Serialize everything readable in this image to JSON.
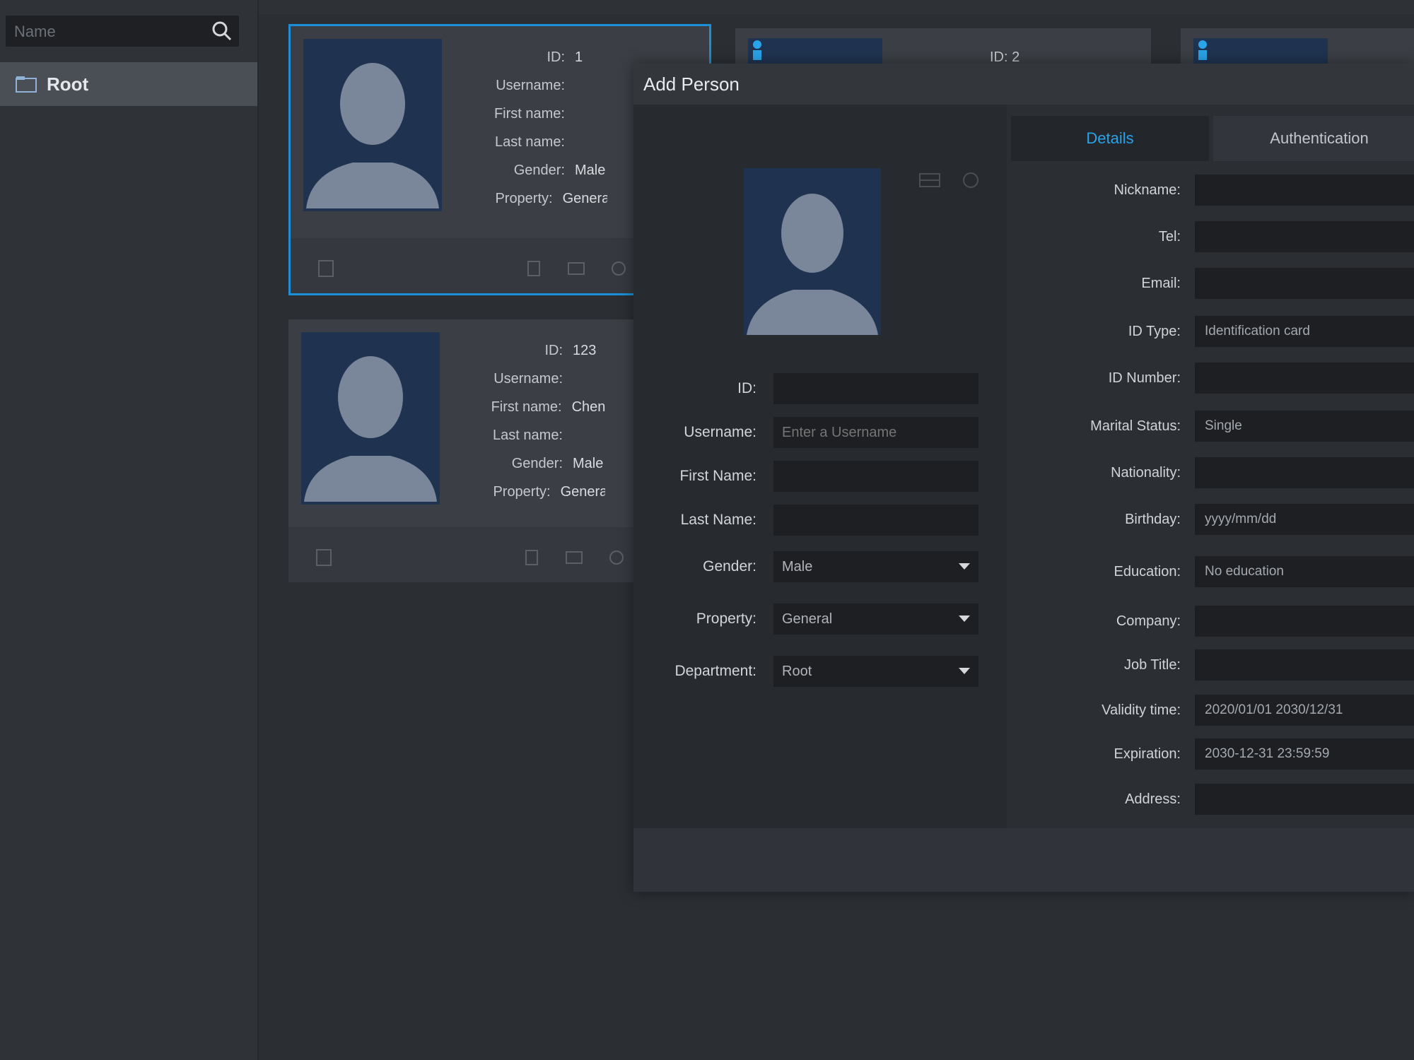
{
  "sidebar": {
    "search_placeholder": "Name",
    "tree_root": "Root"
  },
  "cards": [
    {
      "fields": [
        {
          "k": "ID:",
          "v": "1"
        },
        {
          "k": "Username:",
          "v": ""
        },
        {
          "k": "First name:",
          "v": ""
        },
        {
          "k": "Last name:",
          "v": ""
        },
        {
          "k": "Gender:",
          "v": "Male"
        },
        {
          "k": "Property:",
          "v": "General"
        }
      ]
    },
    {
      "fields": [
        {
          "k": "ID:",
          "v": "123"
        },
        {
          "k": "Username:",
          "v": ""
        },
        {
          "k": "First name:",
          "v": "Chen"
        },
        {
          "k": "Last name:",
          "v": ""
        },
        {
          "k": "Gender:",
          "v": "Male"
        },
        {
          "k": "Property:",
          "v": "General"
        }
      ]
    }
  ],
  "mini_cards": [
    {
      "text": "ID: 2"
    },
    {
      "text": ""
    }
  ],
  "modal": {
    "title": "Add Person",
    "left_fields": [
      {
        "label": "ID:",
        "value": "",
        "placeholder": ""
      },
      {
        "label": "Username:",
        "value": "",
        "placeholder": "Enter a Username"
      },
      {
        "label": "First Name:",
        "value": "",
        "placeholder": ""
      },
      {
        "label": "Last Name:",
        "value": "",
        "placeholder": ""
      }
    ],
    "left_selects": [
      {
        "label": "Gender:",
        "value": "Male"
      },
      {
        "label": "Property:",
        "value": "General"
      },
      {
        "label": "Department:",
        "value": "Root"
      }
    ],
    "tabs": [
      "Details",
      "Authentication"
    ],
    "right_fields": [
      {
        "label": "Nickname:",
        "value": ""
      },
      {
        "label": "Tel:",
        "value": ""
      },
      {
        "label": "Email:",
        "value": ""
      },
      {
        "label": "ID Type:",
        "value": "Identification card"
      },
      {
        "label": "ID Number:",
        "value": ""
      },
      {
        "label": "Marital Status:",
        "value": "Single"
      },
      {
        "label": "Nationality:",
        "value": ""
      },
      {
        "label": "Birthday:",
        "value": "yyyy/mm/dd"
      },
      {
        "label": "Education:",
        "value": "No education"
      },
      {
        "label": "Company:",
        "value": ""
      },
      {
        "label": "Job Title:",
        "value": ""
      },
      {
        "label": "Validity time:",
        "value": "2020/01/01 2030/12/31"
      },
      {
        "label": "Expiration:",
        "value": "2030-12-31 23:59:59"
      },
      {
        "label": "Address:",
        "value": ""
      }
    ]
  },
  "colors": {
    "accent": "#1c8fd6",
    "photo_bg": "#1f3350",
    "silhouette": "#7a869a"
  }
}
